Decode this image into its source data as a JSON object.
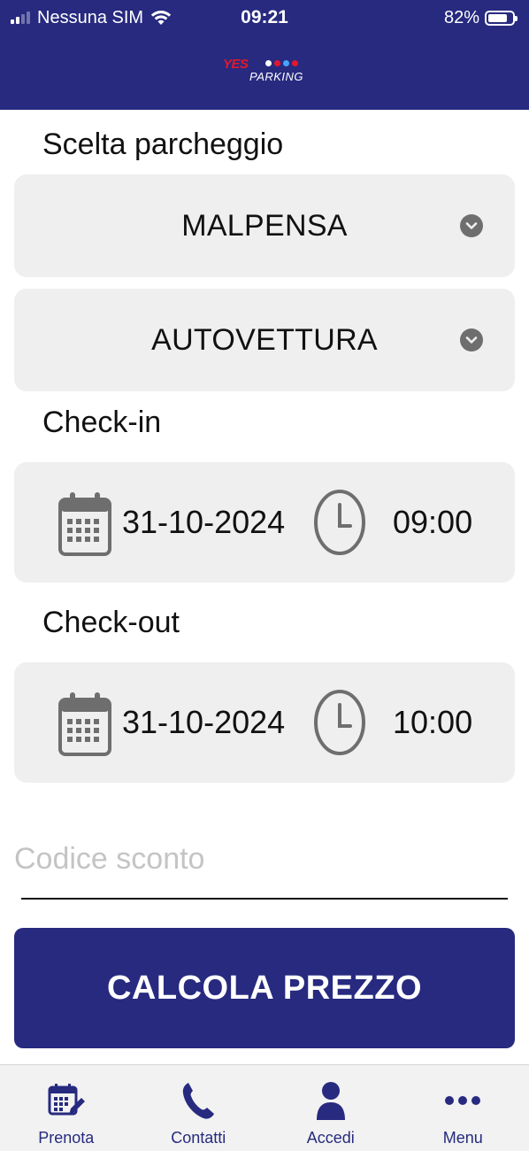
{
  "status_bar": {
    "carrier": "Nessuna SIM",
    "time": "09:21",
    "battery": "82%",
    "battery_level": 0.82
  },
  "header": {
    "logo_yes": "YES",
    "logo_parking": "PARKING",
    "background_color": "#272a7f"
  },
  "parking": {
    "label": "Scelta parcheggio",
    "location": "MALPENSA",
    "vehicle": "AUTOVETTURA"
  },
  "check_in": {
    "label": "Check-in",
    "date": "31-10-2024",
    "time": "09:00"
  },
  "check_out": {
    "label": "Check-out",
    "date": "31-10-2024",
    "time": "10:00"
  },
  "discount": {
    "placeholder": "Codice sconto",
    "value": ""
  },
  "calc_button": {
    "label": "CALCOLA PREZZO"
  },
  "tab_bar": {
    "items": [
      {
        "label": "Prenota",
        "icon": "calendar-pencil-icon"
      },
      {
        "label": "Contatti",
        "icon": "phone-icon"
      },
      {
        "label": "Accedi",
        "icon": "user-icon"
      },
      {
        "label": "Menu",
        "icon": "more-dots-icon"
      }
    ]
  },
  "colors": {
    "brand": "#272a7f",
    "field_background": "#efefef",
    "icon_gray": "#6e6e6e",
    "logo_red": "#e3182d"
  }
}
